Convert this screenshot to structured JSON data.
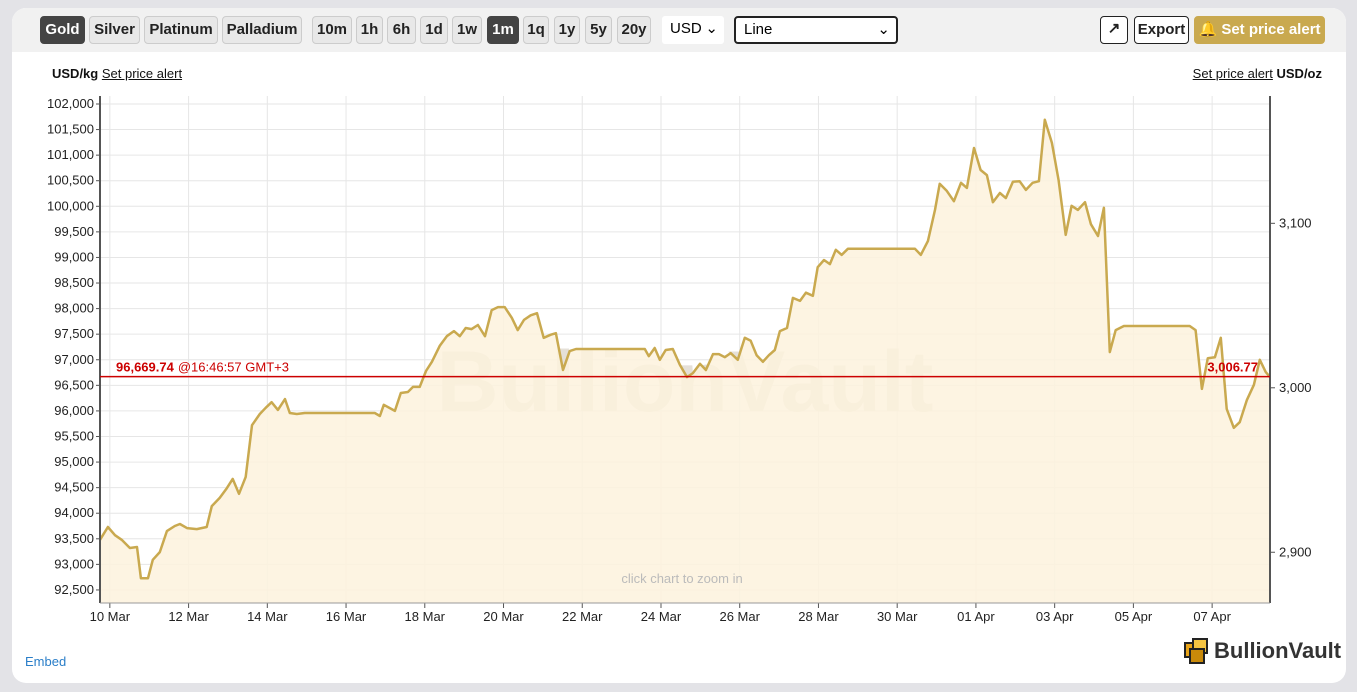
{
  "toolbar": {
    "metals": [
      "Gold",
      "Silver",
      "Platinum",
      "Palladium"
    ],
    "active_metal": "Gold",
    "ranges": [
      "10m",
      "1h",
      "6h",
      "1d",
      "1w",
      "1m",
      "1q",
      "1y",
      "5y",
      "20y"
    ],
    "active_range": "1m",
    "currency": "USD",
    "chart_type": "Line",
    "export_label": "Export",
    "alert_label": "Set price alert"
  },
  "left_label": {
    "unit": "USD/kg",
    "link": "Set price alert"
  },
  "right_label": {
    "unit": "USD/oz",
    "link": "Set price alert"
  },
  "current": {
    "price_kg": "96,669.74",
    "time": "@16:46:57 GMT+3",
    "price_oz": "3,006.77",
    "value": 96669.74
  },
  "hint": "click chart to zoom in",
  "watermark": "BullionVault",
  "embed": "Embed",
  "logo": "BullionVault",
  "colors": {
    "line": "#c9a94f",
    "fill": "#fdf2dd",
    "current": "#cc0000",
    "accent": "#c9a94f"
  },
  "chart_data": {
    "type": "area",
    "x_unit": "days since 10 Mar",
    "xticks": [
      "10 Mar",
      "12 Mar",
      "14 Mar",
      "16 Mar",
      "18 Mar",
      "20 Mar",
      "22 Mar",
      "24 Mar",
      "26 Mar",
      "28 Mar",
      "30 Mar",
      "01 Apr",
      "03 Apr",
      "05 Apr",
      "07 Apr"
    ],
    "xlim": [
      -0.25,
      29.47
    ],
    "ylim": [
      92245,
      102156
    ],
    "yticks_left": [
      "92,500",
      "93,000",
      "93,500",
      "94,000",
      "94,500",
      "95,000",
      "95,500",
      "96,000",
      "96,500",
      "97,000",
      "97,500",
      "98,000",
      "98,500",
      "99,000",
      "99,500",
      "100,000",
      "100,500",
      "101,000",
      "101,500",
      "102,000"
    ],
    "yticks_right": [
      "2,900",
      "3,000",
      "3,100"
    ],
    "oz_per_kg": 32.1507,
    "x": [
      -0.25,
      -0.05,
      0.13,
      0.3,
      0.51,
      0.69,
      0.79,
      0.97,
      1.09,
      1.27,
      1.45,
      1.65,
      1.78,
      1.96,
      2.21,
      2.46,
      2.59,
      2.79,
      2.97,
      3.12,
      3.28,
      3.45,
      3.61,
      3.81,
      3.96,
      4.11,
      4.27,
      4.45,
      4.57,
      4.75,
      4.95,
      6.73,
      6.86,
      6.96,
      7.24,
      7.39,
      7.57,
      7.7,
      7.87,
      8.03,
      8.18,
      8.38,
      8.56,
      8.74,
      8.89,
      9.04,
      9.19,
      9.35,
      9.53,
      9.7,
      9.86,
      10.03,
      10.21,
      10.36,
      10.52,
      10.69,
      10.85,
      11.02,
      11.2,
      11.33,
      11.51,
      11.68,
      11.84,
      13.59,
      13.69,
      13.84,
      13.97,
      14.12,
      14.3,
      14.48,
      14.66,
      14.81,
      14.99,
      15.14,
      15.32,
      15.47,
      15.62,
      15.77,
      15.95,
      16.13,
      16.28,
      16.43,
      16.59,
      16.74,
      16.89,
      17.02,
      17.2,
      17.35,
      17.53,
      17.68,
      17.86,
      17.98,
      18.14,
      18.29,
      18.44,
      18.59,
      18.75,
      20.45,
      20.6,
      20.78,
      20.96,
      21.08,
      21.26,
      21.44,
      21.62,
      21.77,
      21.95,
      22.12,
      22.28,
      22.43,
      22.61,
      22.76,
      22.94,
      23.11,
      23.27,
      23.44,
      23.6,
      23.75,
      23.93,
      24.1,
      24.28,
      24.43,
      24.59,
      24.77,
      24.92,
      25.1,
      25.25,
      25.4,
      25.55,
      25.76,
      27.43,
      27.58,
      27.74,
      27.89,
      28.07,
      28.22,
      28.37,
      28.55,
      28.7,
      28.88,
      29.06,
      29.21,
      29.36,
      29.47
    ],
    "y": [
      93480,
      93730,
      93570,
      93480,
      93320,
      93340,
      92730,
      92730,
      93090,
      93240,
      93650,
      93750,
      93790,
      93710,
      93690,
      93730,
      94140,
      94300,
      94490,
      94670,
      94380,
      94710,
      95720,
      95940,
      96060,
      96170,
      96020,
      96230,
      95960,
      95940,
      95960,
      95960,
      95900,
      96120,
      96000,
      96350,
      96370,
      96470,
      96470,
      96780,
      96960,
      97270,
      97460,
      97560,
      97460,
      97620,
      97600,
      97680,
      97460,
      97970,
      98030,
      98030,
      97820,
      97580,
      97780,
      97870,
      97910,
      97430,
      97490,
      97520,
      96800,
      97170,
      97210,
      97210,
      97070,
      97230,
      97000,
      97190,
      97210,
      96900,
      96660,
      96740,
      96920,
      96800,
      97110,
      97110,
      97050,
      97130,
      97000,
      97430,
      97370,
      97090,
      96960,
      97090,
      97190,
      97560,
      97620,
      98210,
      98150,
      98310,
      98250,
      98810,
      98950,
      98870,
      99150,
      99050,
      99170,
      99170,
      99050,
      99320,
      99930,
      100440,
      100300,
      100100,
      100460,
      100360,
      101140,
      100710,
      100610,
      100080,
      100260,
      100160,
      100480,
      100490,
      100320,
      100460,
      100490,
      101690,
      101240,
      100510,
      99440,
      100010,
      99930,
      100080,
      99650,
      99420,
      99970,
      97150,
      97580,
      97660,
      97660,
      97580,
      96430,
      97030,
      97050,
      97430,
      96040,
      95670,
      95780,
      96210,
      96510,
      97000,
      96760,
      96660
    ]
  }
}
